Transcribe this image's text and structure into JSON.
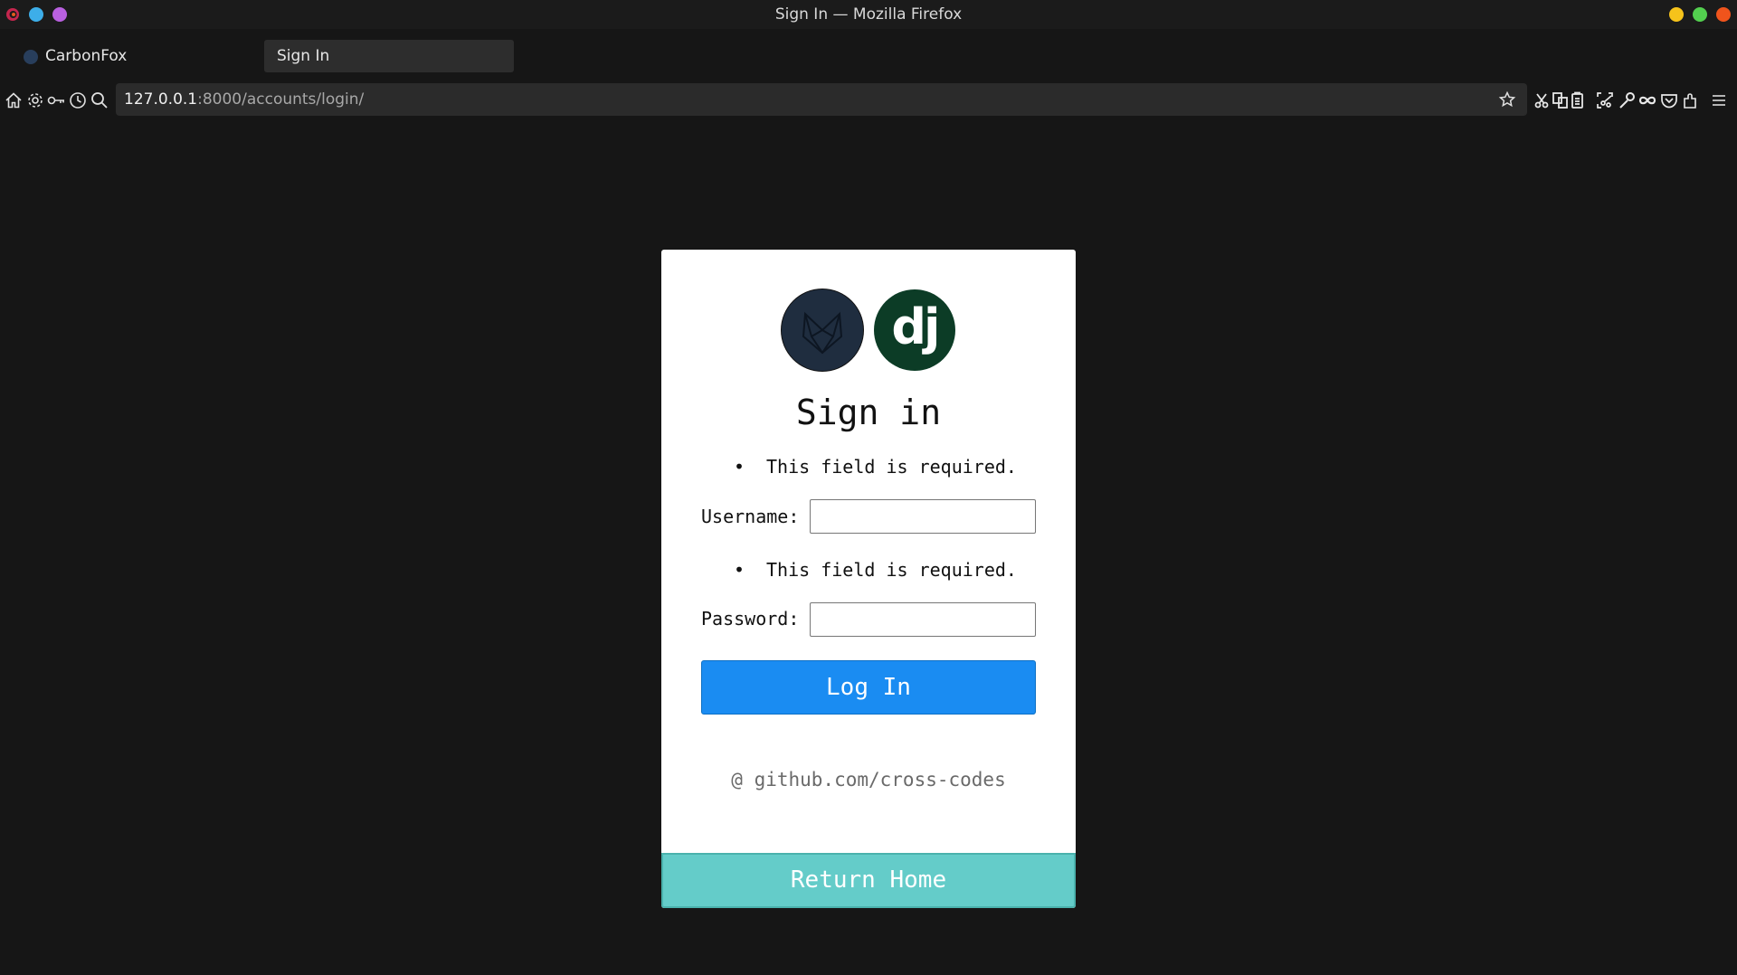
{
  "window": {
    "title": "Sign In — Mozilla Firefox"
  },
  "tabs": [
    {
      "label": "CarbonFox",
      "active": false
    },
    {
      "label": "Sign In",
      "active": true
    }
  ],
  "navbar": {
    "url_host": "127.0.0.1",
    "url_rest": ":8000/accounts/login/",
    "left_icons": [
      "home-icon",
      "gear-icon",
      "key-icon",
      "history-icon",
      "search-icon"
    ],
    "right_icons": [
      "scissors-icon",
      "copy-icon",
      "clipboard-icon",
      "screenshot-icon",
      "wrench-icon",
      "infinity-icon",
      "pocket-icon",
      "extensions-icon",
      "menu-icon"
    ]
  },
  "colors": {
    "page_bg": "#161616",
    "login_button": "#1a8cf2",
    "home_button": "#64ccc9",
    "django_green": "#0c3c26",
    "fox_navy": "#1f2d3f"
  },
  "login": {
    "logo_text": "dj",
    "heading": "Sign in",
    "username_error": "This field is required.",
    "username_label": "Username:",
    "username_value": "",
    "password_error": "This field is required.",
    "password_label": "Password:",
    "password_value": "",
    "submit_label": "Log In",
    "credit": "@ github.com/cross-codes",
    "return_label": "Return Home"
  }
}
